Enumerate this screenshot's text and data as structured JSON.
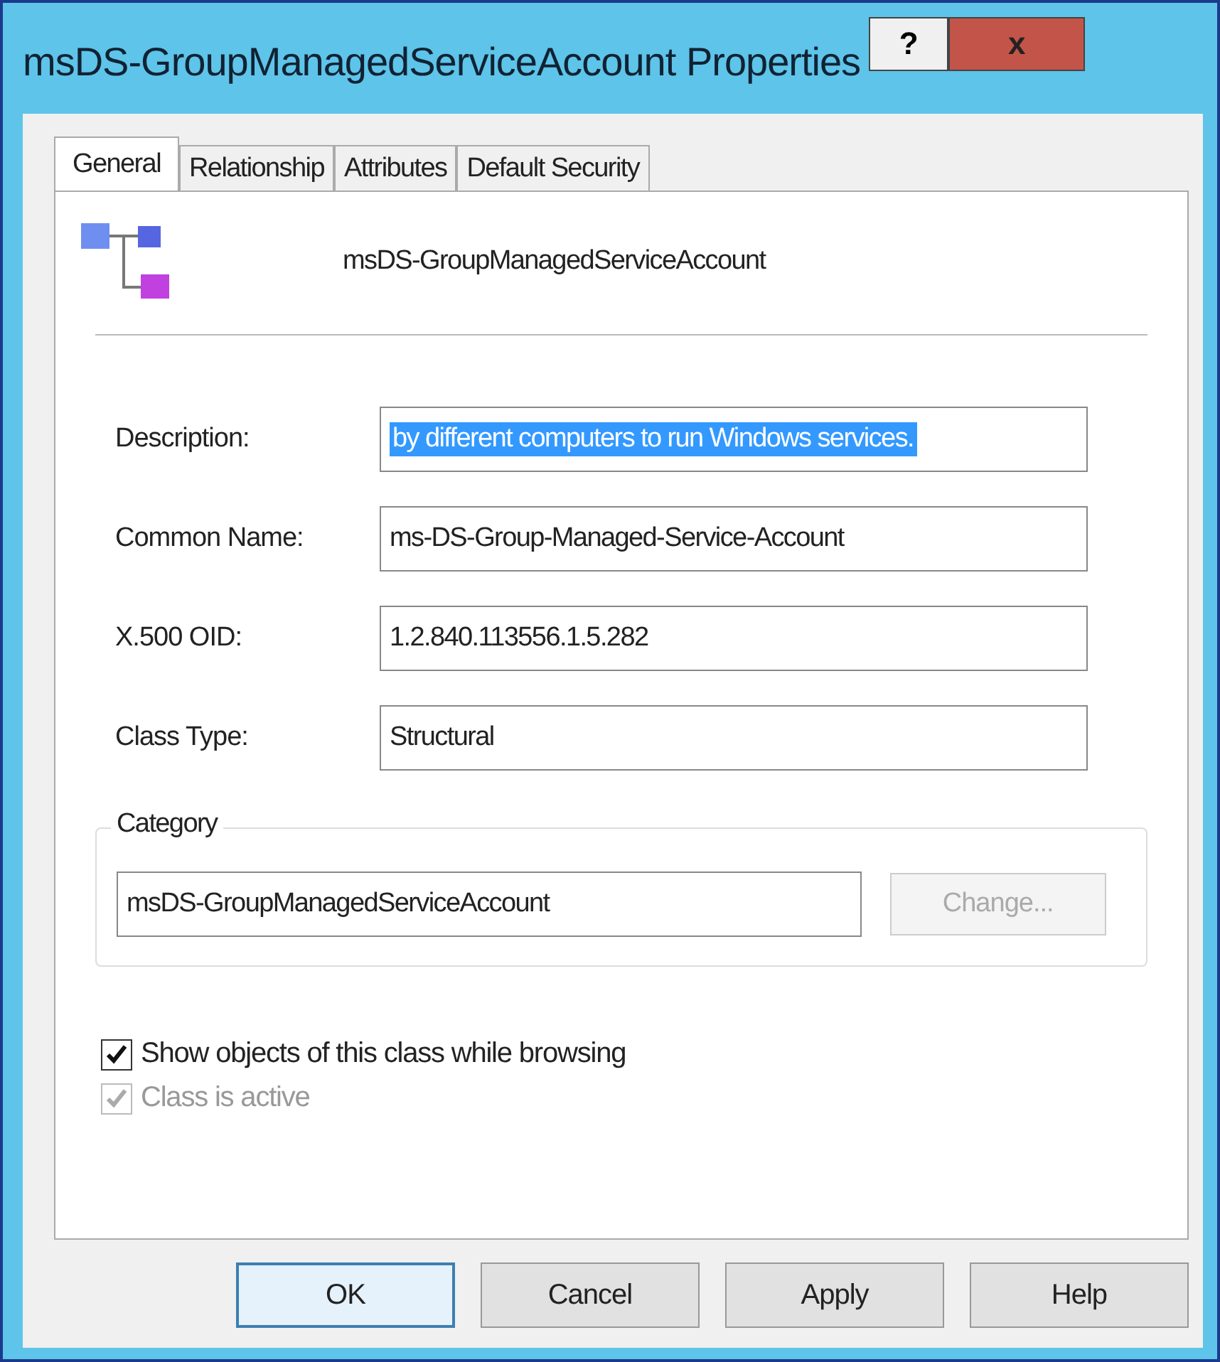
{
  "window": {
    "title": "msDS-GroupManagedServiceAccount Properties",
    "help_button": "?",
    "close_button": "x"
  },
  "tabs": [
    {
      "label": "General",
      "selected": true
    },
    {
      "label": "Relationship",
      "selected": false
    },
    {
      "label": "Attributes",
      "selected": false
    },
    {
      "label": "Default Security",
      "selected": false
    }
  ],
  "header": {
    "name": "msDS-GroupManagedServiceAccount"
  },
  "fields": [
    {
      "label": "Description:",
      "value": "by different computers to run Windows services.",
      "text_selected": true
    },
    {
      "label": "Common Name:",
      "value": "ms-DS-Group-Managed-Service-Account",
      "text_selected": false
    },
    {
      "label": "X.500 OID:",
      "value": "1.2.840.113556.1.5.282",
      "text_selected": false
    },
    {
      "label": "Class Type:",
      "value": "Structural",
      "text_selected": false
    }
  ],
  "category": {
    "legend": "Category",
    "value": "msDS-GroupManagedServiceAccount",
    "button": {
      "label": "Change...",
      "disabled": true
    }
  },
  "checkboxes": [
    {
      "label": "Show objects of this class while browsing",
      "checked": true,
      "disabled": false
    },
    {
      "label": "Class is active",
      "checked": true,
      "disabled": true
    }
  ],
  "buttons": [
    {
      "label": "OK",
      "default": true
    },
    {
      "label": "Cancel",
      "default": false
    },
    {
      "label": "Apply",
      "default": false
    },
    {
      "label": "Help",
      "default": false
    }
  ]
}
